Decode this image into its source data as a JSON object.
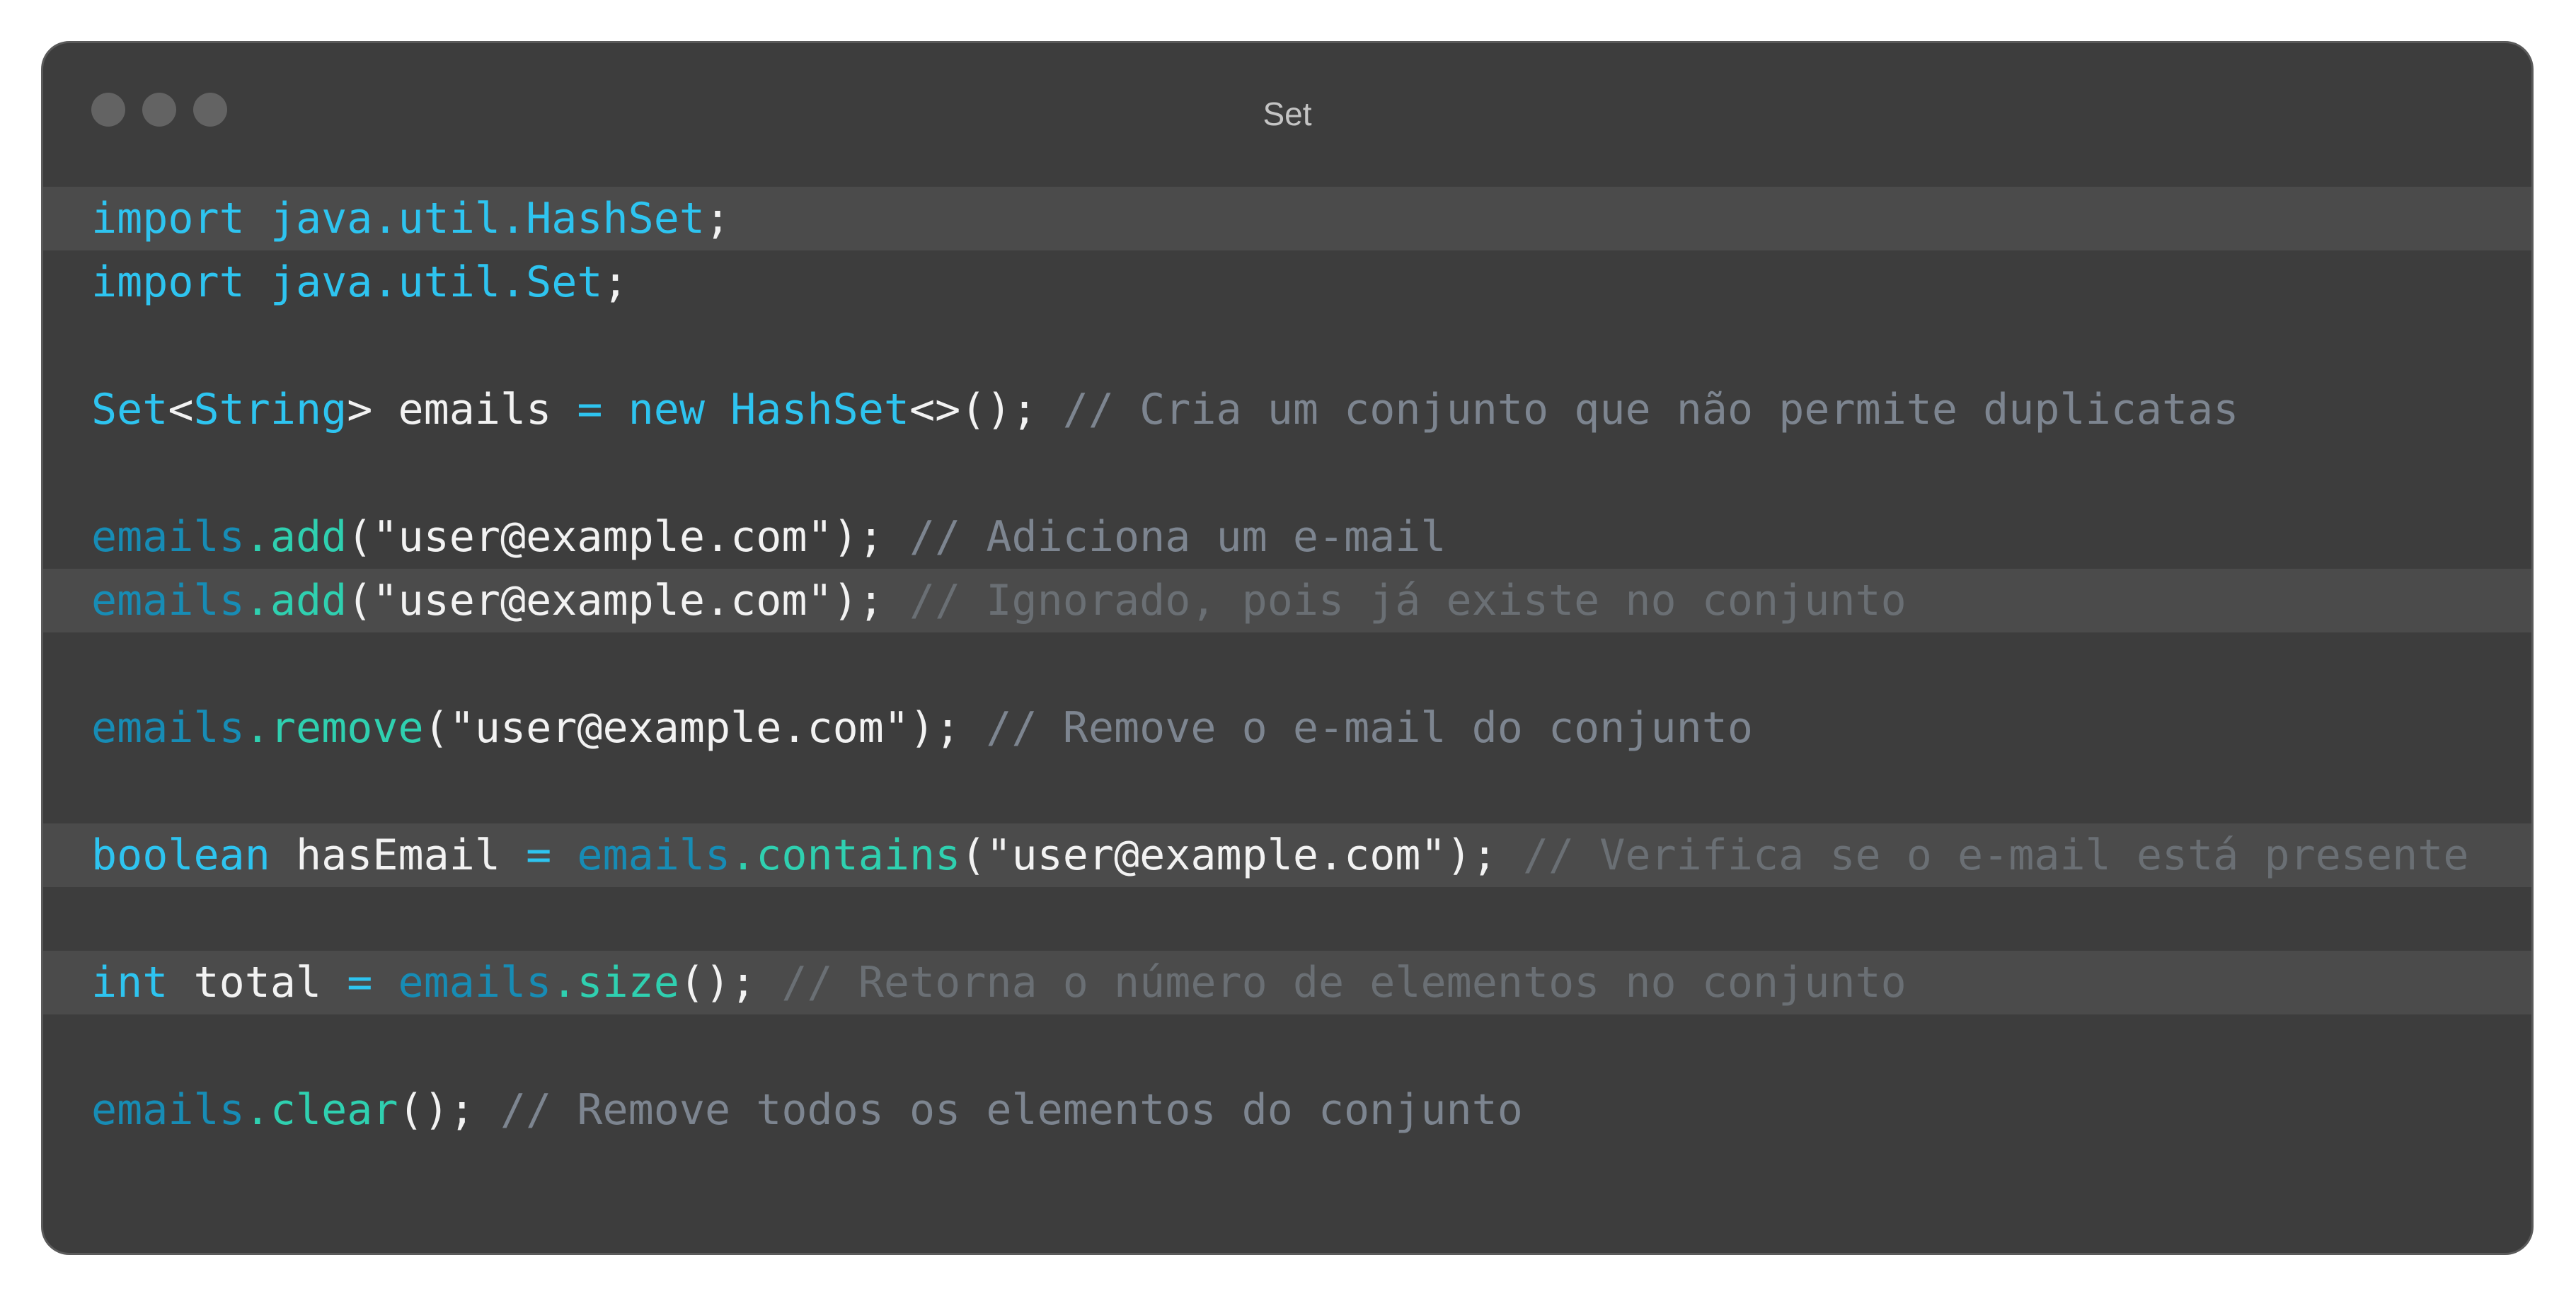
{
  "window": {
    "title": "Set"
  },
  "code": {
    "lines": [
      {
        "import_kw": "import",
        "import_path": "java.util.HashSet",
        "semi": ";"
      },
      {
        "import_kw": "import",
        "import_path": "java.util.Set",
        "semi": ";"
      },
      {
        "type_set": "Set",
        "lt": "<",
        "type_string": "String",
        "gt": ">",
        "var": "emails",
        "eq": "=",
        "new_kw": "new",
        "type_hashset": "HashSet",
        "diamond": "<>();",
        "comment": "// Cria um conjunto que não permite duplicatas"
      },
      {
        "obj": "emails",
        "dot": ".",
        "method": "add",
        "args": "(\"user@example.com\");",
        "comment": "// Adiciona um e-mail"
      },
      {
        "obj": "emails",
        "dot": ".",
        "method": "add",
        "args": "(\"user@example.com\");",
        "comment": "// Ignorado, pois já existe no conjunto"
      },
      {
        "obj": "emails",
        "dot": ".",
        "method": "remove",
        "args": "(\"user@example.com\");",
        "comment": "// Remove o e-mail do conjunto"
      },
      {
        "type": "boolean",
        "var": "hasEmail",
        "eq": "=",
        "obj": "emails",
        "dot": ".",
        "method": "contains",
        "args": "(\"user@example.com\");",
        "comment": "// Verifica se o e-mail está presente"
      },
      {
        "type": "int",
        "var": "total",
        "eq": "=",
        "obj": "emails",
        "dot": ".",
        "method": "size",
        "args": "();",
        "comment": "// Retorna o número de elementos no conjunto"
      },
      {
        "obj": "emails",
        "dot": ".",
        "method": "clear",
        "args": "();",
        "comment": "// Remove todos os elementos do conjunto"
      }
    ]
  },
  "colors": {
    "window_bg": "#3d3d3d",
    "highlight_bg": "#4b4b4b",
    "keyword": "#2ec4f0",
    "object": "#178cb5",
    "method": "#2fd0b0",
    "comment": "#7d8590",
    "text": "#f2f2f2"
  }
}
